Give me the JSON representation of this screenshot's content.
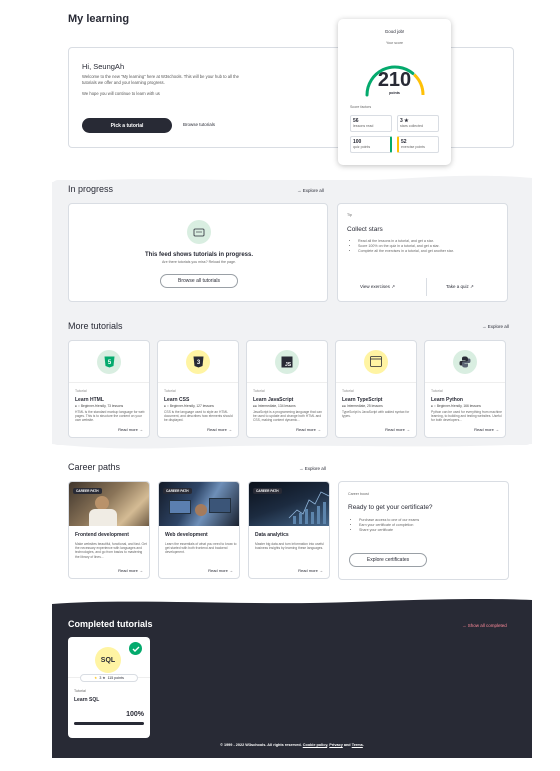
{
  "page_title": "My learning",
  "welcome": {
    "greeting": "Hi, SeungAh",
    "line1": "Welcome to the new \"My learning\" here at W3schools. This will be your hub to all the",
    "line2": "tutorials we offer and your learning progress.",
    "line3": "We hope you will continue to learn with us",
    "pick_button": "Pick a tutorial",
    "browse_link": "Browse tutorials"
  },
  "score": {
    "heading": "Good job!",
    "your_score": "Your score",
    "value": "210",
    "unit": "points",
    "factors_label": "Score factors",
    "progress": 0.72,
    "factors": [
      {
        "value": "56",
        "label": "lessons read"
      },
      {
        "value": "3 ★",
        "label": "stars collected"
      },
      {
        "value": "100",
        "label": "quiz points"
      },
      {
        "value": "52",
        "label": "exercise points"
      }
    ],
    "colors": {
      "green": "#04aa6d",
      "yellow": "#ffc107"
    }
  },
  "in_progress": {
    "title": "In progress",
    "explore": "Explore all",
    "empty_title": "This feed shows tutorials in progress.",
    "empty_sub": "Are there tutorials you miss? Reload the page.",
    "browse_all": "Browse all tutorials"
  },
  "tip": {
    "label": "Tip",
    "title": "Collect stars",
    "items": [
      "Read all the lessons in a tutorial, and get a star.",
      "Score 100% on the quiz in a tutorial, and get a star.",
      "Complete all the exercises in a tutorial, and get another star."
    ],
    "view_exercises": "View exercises",
    "take_quiz": "Take a quiz"
  },
  "more_tutorials": {
    "title": "More tutorials",
    "explore": "Explore all",
    "cards": [
      {
        "tag": "Tutorial",
        "title": "Learn HTML",
        "meta": "● ○ Beginner-friendly, 73 lessons",
        "desc": "HTML is the standard markup language for web pages. This is to structure the content on your own website.",
        "icon": "HTML5",
        "bg": "#d9eee1",
        "fg": "#04aa6d"
      },
      {
        "tag": "Tutorial",
        "title": "Learn CSS",
        "meta": "● ○ Beginner-friendly, 127 lessons",
        "desc": "CSS is the language used to style an HTML document, and describes how elements should be displayed.",
        "icon": "CSS3",
        "bg": "#fff4a3",
        "fg": "#282a35"
      },
      {
        "tag": "Tutorial",
        "title": "Learn JavaScript",
        "meta": "●● Intermediate, 134 lessons",
        "desc": "JavaScript is a programming language that can be used to update and change both HTML and CSS, making content dynamic...",
        "icon": "JS",
        "bg": "#d9eee1",
        "fg": "#282a35"
      },
      {
        "tag": "Tutorial",
        "title": "Learn TypeScript",
        "meta": "●● Intermediate, 25 lessons",
        "desc": "TypeScript is JavaScript with added syntax for types.",
        "icon": "TS",
        "bg": "#fff4a3",
        "fg": "#282a35"
      },
      {
        "tag": "Tutorial",
        "title": "Learn Python",
        "meta": "● ○ Beginner-friendly, 166 lessons",
        "desc": "Python can be used for everything from machine learning, to building and testing websites. Useful for both developers...",
        "icon": "PY",
        "bg": "#d9eee1",
        "fg": "#282a35"
      }
    ],
    "read_more": "Read more"
  },
  "career": {
    "title": "Career paths",
    "explore": "Explore all",
    "tag": "CAREER PATH",
    "cards": [
      {
        "title": "Frontend development",
        "desc": "Make websites beautiful, functional, and fast. Get the necessary experience with languages and technologies, and go from basics to mastering the library of lines...",
        "img1": "#6b5a48",
        "img2": "#c9b08a"
      },
      {
        "title": "Web development",
        "desc": "Learn the essentials of what you need to know to get started with both frontend and backend development.",
        "img1": "#1b2635",
        "img2": "#4a6d9a"
      },
      {
        "title": "Data analytics",
        "desc": "Master big data and turn information into useful business insights by learning these languages.",
        "img1": "#0d1420",
        "img2": "#3d5a7a"
      }
    ],
    "read_more": "Read more"
  },
  "certificate": {
    "label": "Career boost",
    "title": "Ready to get your certificate?",
    "items": [
      "Purchase access to one of our exams",
      "Earn your certificate of completion",
      "Share your certificate"
    ],
    "button": "Explore certificates"
  },
  "completed": {
    "title": "Completed tutorials",
    "show_all": "Show all completed",
    "card": {
      "icon": "SQL",
      "stars": "3 ★",
      "points": "115 points",
      "tag": "Tutorial",
      "title": "Learn SQL",
      "percent": "100%",
      "progress": 1.0
    }
  },
  "footer": {
    "text": "© 1999 - 2022 W3schools. All rights reserved.",
    "cookie": "Cookie policy",
    "privacy": "Privacy",
    "and": "and",
    "terms": "Terms"
  },
  "read_more_arrow": "→"
}
